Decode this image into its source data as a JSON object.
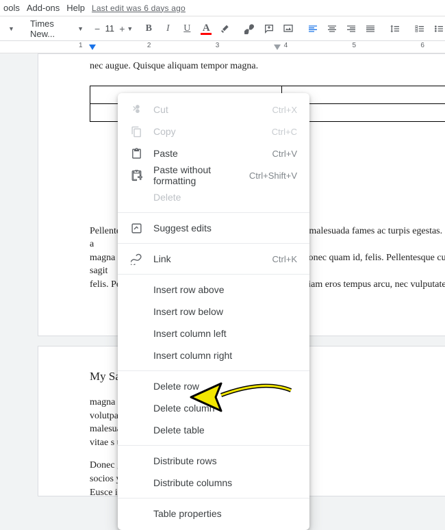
{
  "menubar": {
    "items": [
      "ools",
      "Add-ons",
      "Help"
    ],
    "edit_info": "Last edit was 6 days ago"
  },
  "toolbar": {
    "font": "Times New...",
    "font_size": "11",
    "text_color_letter": "A"
  },
  "ruler": {
    "marks": [
      "1",
      "2",
      "3",
      "4",
      "5",
      "6"
    ]
  },
  "doc": {
    "top_line": "nec augue. Quisque aliquam tempor magna.",
    "para_lines": [
      "Pellentesque habitant morbi tristique senectus et netus et malesuada fames ac turpis egestas. Nunc a",
      "magna non nibh accumsan venenatis. Praesent id nibh. Donec quam id, felis. Pellentesque cursus sagit",
      "felis. Pellentesque porttitor, velit lacinia egestas auctor, diam eros tempus arcu, nec vulputate augue"
    ],
    "page2_heading": "My Sa",
    "page2_para1": [
      "magna                                                                            . Vivamus a mi. Morbi neque. Aliquam",
      "volutpat                                                                            morbi tristique senectus et netus et",
      "malesuada                                                                       sollicitudin posuere, metus quam iaculi",
      "vitae s                                                                               um vel, ultricies vel, faucibus at, quam"
    ],
    "page2_para2": [
      "Donec                                                                              , wisi. In in nunc. Class aptent taciti",
      "socios                                                                              ymenaeos. Donec ullamcorper fringill",
      "Eusce                                                                              idae penatibus et magnis dis parturient"
    ]
  },
  "ctx": {
    "items": [
      {
        "id": "cut",
        "label": "Cut",
        "shortcut": "Ctrl+X",
        "icon": "cut-icon",
        "enabled": false
      },
      {
        "id": "copy",
        "label": "Copy",
        "shortcut": "Ctrl+C",
        "icon": "copy-icon",
        "enabled": false
      },
      {
        "id": "paste",
        "label": "Paste",
        "shortcut": "Ctrl+V",
        "icon": "paste-icon",
        "enabled": true
      },
      {
        "id": "paste-nofmt",
        "label": "Paste without formatting",
        "shortcut": "Ctrl+Shift+V",
        "icon": "paste-plain-icon",
        "enabled": true
      },
      {
        "id": "delete",
        "label": "Delete",
        "shortcut": "",
        "icon": "",
        "enabled": false
      }
    ],
    "sep1": true,
    "suggest": {
      "label": "Suggest edits",
      "icon": "suggest-icon"
    },
    "sep2": true,
    "link": {
      "label": "Link",
      "shortcut": "Ctrl+K",
      "icon": "link-icon"
    },
    "sep3": true,
    "table_ops": [
      "Insert row above",
      "Insert row below",
      "Insert column left",
      "Insert column right"
    ],
    "sep4": true,
    "delete_ops": [
      "Delete row",
      "Delete column",
      "Delete table"
    ],
    "sep5": true,
    "dist_ops": [
      "Distribute rows",
      "Distribute columns"
    ],
    "sep6": true,
    "props": "Table properties"
  }
}
